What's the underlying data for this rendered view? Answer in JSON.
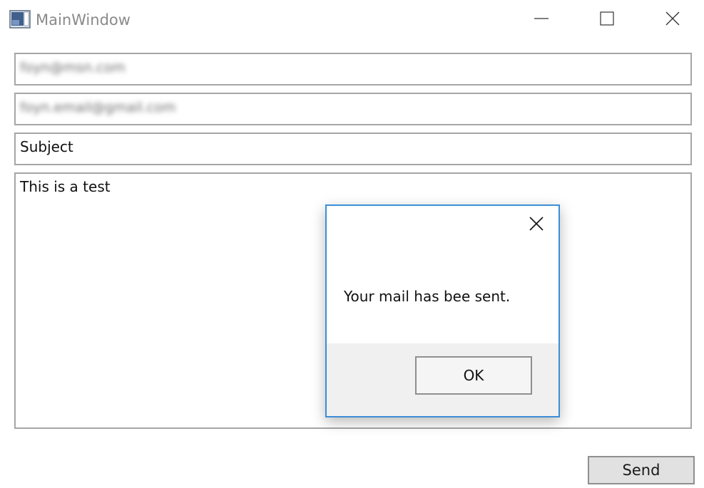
{
  "window": {
    "title": "MainWindow",
    "icon": "window-app-icon",
    "controls": {
      "minimize_icon": "minimize-icon",
      "maximize_icon": "maximize-icon",
      "close_icon": "close-icon"
    }
  },
  "form": {
    "from_value": "foyn@msn.com",
    "to_value": "foyn.email@gmail.com",
    "subject_value": "Subject",
    "body_value": "This is a test",
    "send_label": "Send"
  },
  "dialog": {
    "message": "Your mail has bee sent.",
    "ok_label": "OK",
    "close_icon": "close-icon",
    "accent_color": "#3c8ed6"
  }
}
